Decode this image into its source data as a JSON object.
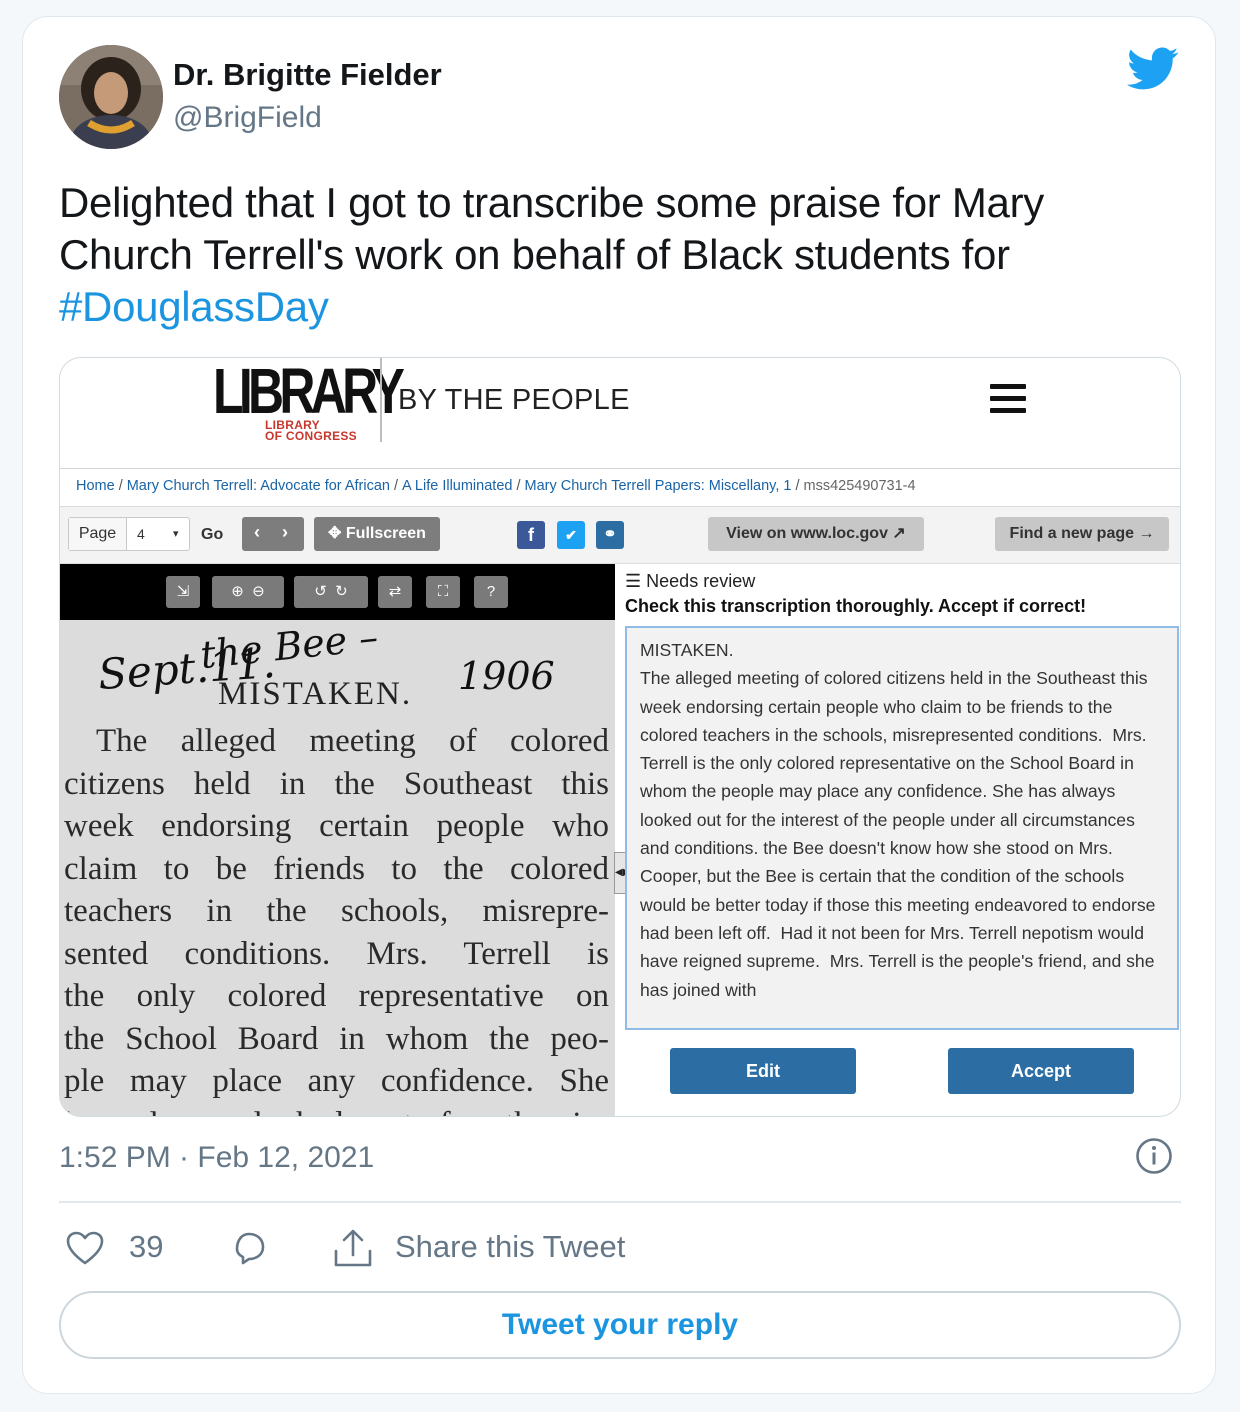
{
  "author": {
    "display_name": "Dr. Brigitte Fielder",
    "handle": "@BrigField"
  },
  "tweet": {
    "text_line1": "Delighted that I got to transcribe some praise for Mary",
    "text_line2": "Church Terrell's work on behalf of Black students for",
    "hashtag": "#DouglassDay",
    "timestamp": "1:52 PM · Feb 12, 2021",
    "likes": "39",
    "share_label": "Share this Tweet",
    "reply_label": "Tweet your reply"
  },
  "screenshot": {
    "logo_word": "LIBRARY",
    "logo_sub_1": "LIBRARY",
    "logo_sub_2": "OF CONGRESS",
    "site_title": "BY THE PEOPLE",
    "breadcrumb": {
      "home": "Home",
      "campaign": "Mary Church Terrell: Advocate for African",
      "project": "A Life Illuminated",
      "item": "Mary Church Terrell Papers: Miscellany, 1",
      "asset": "mss425490731-4"
    },
    "toolbar": {
      "page_label": "Page",
      "page_value": "4",
      "go_label": "Go",
      "fullscreen_label": "Fullscreen",
      "view_loc_label": "View on www.loc.gov",
      "find_page_label": "Find a new page →"
    },
    "review": {
      "status": "Needs review",
      "instruction": "Check this transcription thoroughly. Accept if correct!"
    },
    "clipping": {
      "handwriting_1": "Sept.11.",
      "handwriting_2": "the Bee –",
      "year": "1906",
      "title": "MISTAKEN.",
      "lines": [
        "The alleged meeting of colored",
        "citizens held in the Southeast this",
        "week endorsing certain people who",
        "claim to be friends to the colored",
        "teachers in the schools, misrepre-",
        "sented conditions. Mrs. Terrell is",
        "the only colored representative on",
        "the School Board in whom the peo-",
        "ple may place any confidence. She",
        "has always looked out for the in-"
      ]
    },
    "transcription": "MISTAKEN.\nThe alleged meeting of colored citizens held in the Southeast this week endorsing certain people who claim to be friends to the colored teachers in the schools, misrepresented conditions.  Mrs. Terrell is the only colored representative on the School Board in whom the people may place any confidence. She has always looked out for the interest of the people under all circumstances and conditions. the Bee doesn't know how she stood on Mrs. Cooper, but the Bee is certain that the condition of the schools would be better today if those this meeting endeavored to endorse had been left off.  Had it not been for Mrs. Terrell nepotism would have reigned supreme.  Mrs. Terrell is the people's friend, and she has joined with",
    "edit_label": "Edit",
    "accept_label": "Accept"
  },
  "colors": {
    "link": "#1b95e0",
    "text": "#14171a",
    "muted": "#657786",
    "loc_button": "#2c6ea3"
  }
}
